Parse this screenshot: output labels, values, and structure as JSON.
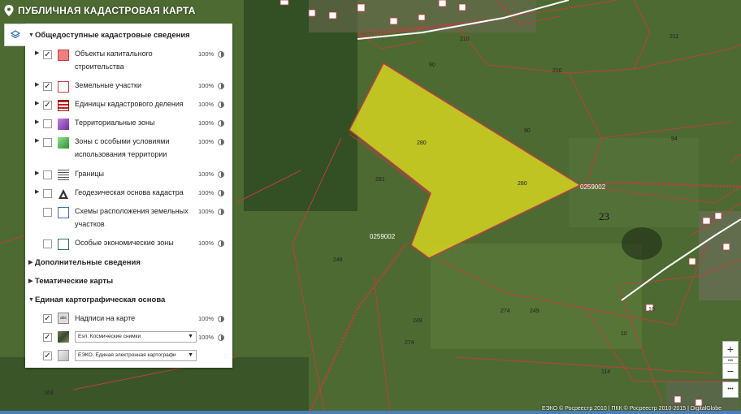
{
  "header": {
    "title": "ПУБЛИЧНАЯ КАДАСТРОВАЯ КАРТА"
  },
  "panel": {
    "section_public": "Общедоступные кадастровые сведения",
    "layers": [
      {
        "label": "Объекты капитального строительства",
        "percent": "100%",
        "checked": "✓"
      },
      {
        "label": "Земельные участки",
        "percent": "100%",
        "checked": "✓"
      },
      {
        "label": "Единицы кадастрового деления",
        "percent": "100%",
        "checked": "✓"
      },
      {
        "label": "Территориальные зоны",
        "percent": "100%"
      },
      {
        "label": "Зоны с особыми условиями использования территории",
        "percent": "100%"
      },
      {
        "label": "Границы",
        "percent": "100%"
      },
      {
        "label": "Геодезическая основа кадастра",
        "percent": "100%"
      },
      {
        "label": "Схемы расположения земельных участков",
        "percent": "100%"
      },
      {
        "label": "Особые экономические зоны",
        "percent": "100%"
      }
    ],
    "section_extra": "Дополнительные сведения",
    "section_thematic": "Тематические карты",
    "section_base": "Единая картографическая основа",
    "base_layers": [
      {
        "label": "Надписи на карте",
        "percent": "100%",
        "checked": "✓"
      },
      {
        "select": "Esri. Космические снимки",
        "percent": "100%",
        "checked": "✓"
      },
      {
        "select": "ЕЭКО. Единая электронная картографи",
        "checked": "✓"
      }
    ]
  },
  "map": {
    "parcel_labels": [
      "210",
      "211",
      "210",
      "90",
      "90",
      "94",
      "280",
      "280",
      "281",
      "248",
      "249",
      "274",
      "274",
      "249",
      "10",
      "114",
      "163",
      "10",
      "23"
    ],
    "district_labels": [
      "0259002",
      "0259002"
    ],
    "highlight_color": "#d4d321"
  },
  "controls": {
    "zoom_in": "+",
    "zoom_out": "−",
    "more": "•••"
  },
  "attribution": "ЕЭКО © Росреестр 2010 | ПКК © Росреестр 2010-2015 | DigitalGlobe"
}
